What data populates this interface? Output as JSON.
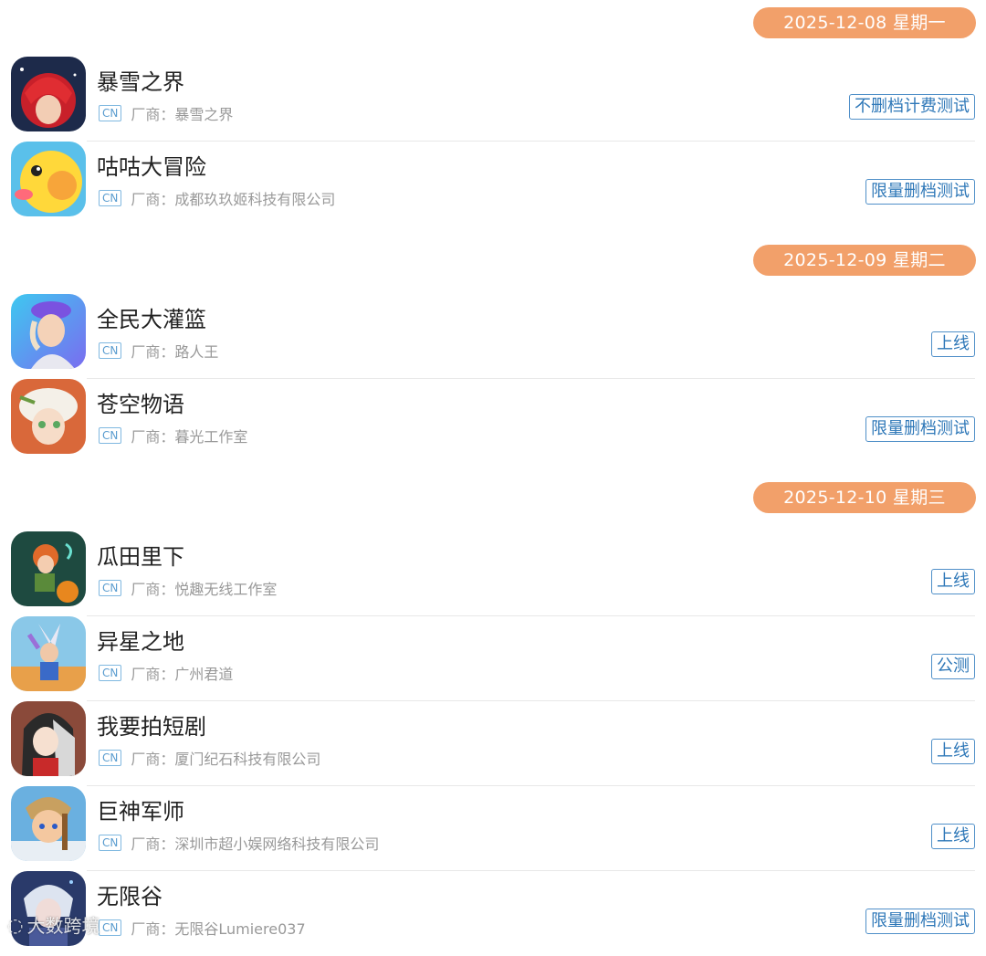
{
  "vendor_prefix": "厂商：",
  "cn_label": "CN",
  "groups": [
    {
      "date": "2025-12-08 星期一",
      "games": [
        {
          "name": "暴雪之界",
          "vendor": "暴雪之界",
          "tag": "不删档计费测试",
          "icon": "red-haired-character-icon"
        },
        {
          "name": "咕咕大冒险",
          "vendor": "成都玖玖姬科技有限公司",
          "tag": "限量删档测试",
          "icon": "yellow-bird-icon"
        }
      ]
    },
    {
      "date": "2025-12-09 星期二",
      "games": [
        {
          "name": "全民大灌篮",
          "vendor": "路人王",
          "tag": "上线",
          "icon": "basketball-player-icon"
        },
        {
          "name": "苍空物语",
          "vendor": "暮光工作室",
          "tag": "限量删档测试",
          "icon": "white-haired-girl-icon"
        }
      ]
    },
    {
      "date": "2025-12-10 星期三",
      "games": [
        {
          "name": "瓜田里下",
          "vendor": "悦趣无线工作室",
          "tag": "上线",
          "icon": "pumpkin-field-girl-icon"
        },
        {
          "name": "异星之地",
          "vendor": "广州君道",
          "tag": "公测",
          "icon": "alien-adventurer-icon"
        },
        {
          "name": "我要拍短剧",
          "vendor": "厦门纪石科技有限公司",
          "tag": "上线",
          "icon": "drama-girl-icon"
        },
        {
          "name": "巨神军师",
          "vendor": "深圳市超小娱网络科技有限公司",
          "tag": "上线",
          "icon": "chibi-warrior-icon"
        },
        {
          "name": "无限谷",
          "vendor": "无限谷Lumiere037",
          "tag": "限量删档测试",
          "icon": "silver-haired-man-icon"
        }
      ]
    }
  ],
  "watermark": "大数跨境"
}
